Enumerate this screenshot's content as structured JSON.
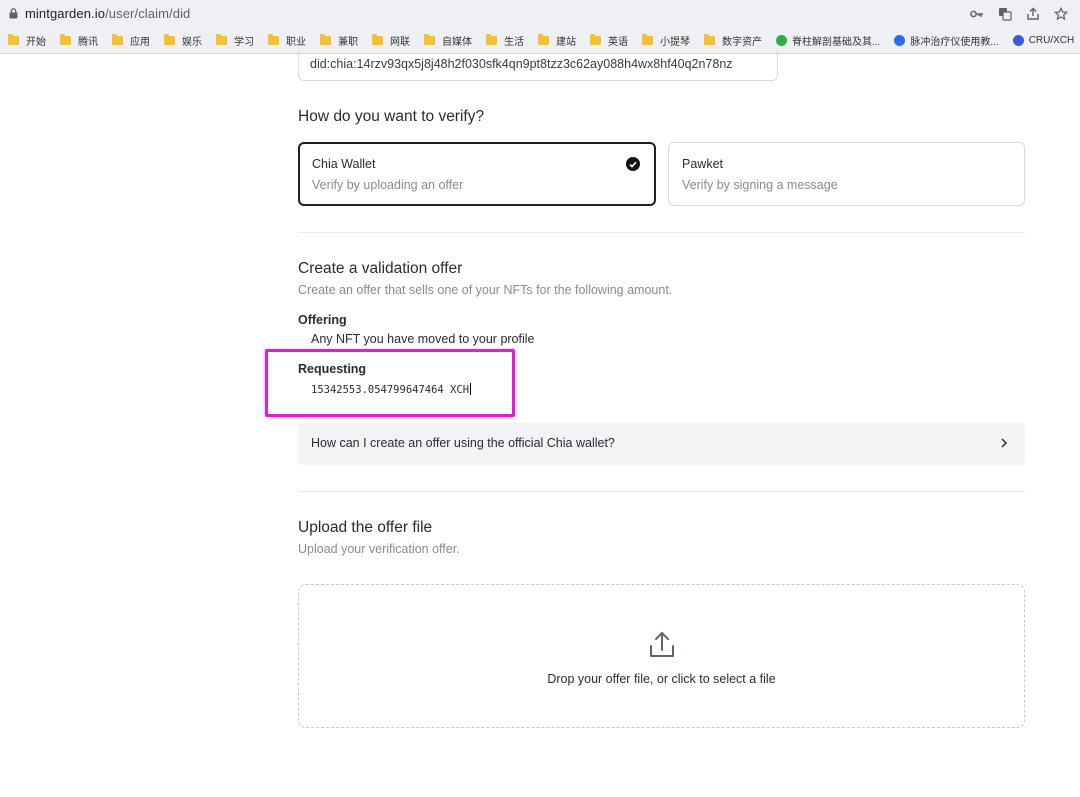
{
  "browser": {
    "url_host": "mintgarden.io",
    "url_path": "/user/claim/did",
    "bookmarks": [
      {
        "label": "开始",
        "icon": "folder-icon"
      },
      {
        "label": "腾讯",
        "icon": "folder-icon"
      },
      {
        "label": "应用",
        "icon": "folder-icon"
      },
      {
        "label": "娱乐",
        "icon": "folder-icon"
      },
      {
        "label": "学习",
        "icon": "folder-icon"
      },
      {
        "label": "职业",
        "icon": "folder-icon"
      },
      {
        "label": "兼职",
        "icon": "folder-icon"
      },
      {
        "label": "网联",
        "icon": "folder-icon"
      },
      {
        "label": "自媒体",
        "icon": "folder-icon"
      },
      {
        "label": "生活",
        "icon": "folder-icon"
      },
      {
        "label": "建站",
        "icon": "folder-icon"
      },
      {
        "label": "英语",
        "icon": "folder-icon"
      },
      {
        "label": "小提琴",
        "icon": "folder-icon"
      },
      {
        "label": "数字资产",
        "icon": "folder-icon"
      },
      {
        "label": "脊柱解剖基础及其...",
        "icon": "green-site-icon"
      },
      {
        "label": "脉冲治疗仪使用教...",
        "icon": "baidu-paw-icon"
      },
      {
        "label": "CRU/XCH",
        "icon": "blue-site-icon"
      }
    ]
  },
  "did_field": {
    "value": "did:chia:14rzv93qx5j8j48h2f030sfk4qn9pt8tzz3c62ay088h4wx8hf40q2n78nz"
  },
  "verify": {
    "heading": "How do you want to verify?",
    "options": [
      {
        "title": "Chia Wallet",
        "subtitle": "Verify by uploading an offer",
        "selected": true
      },
      {
        "title": "Pawket",
        "subtitle": "Verify by signing a message",
        "selected": false
      }
    ]
  },
  "validation": {
    "heading": "Create a validation offer",
    "subtitle": "Create an offer that sells one of your NFTs for the following amount.",
    "offering_label": "Offering",
    "offering_value": "Any NFT you have moved to your profile",
    "requesting_label": "Requesting",
    "requesting_value": "15342553.054799647464 XCH",
    "faq": "How can I create an offer using the official Chia wallet?"
  },
  "upload": {
    "heading": "Upload the offer file",
    "subtitle": "Upload your verification offer.",
    "drop_text": "Drop your offer file, or click to select a file"
  },
  "colors": {
    "highlight": "#e01fd4",
    "selected_border": "#1f1f25",
    "muted_text": "#8a8a93",
    "faq_bg": "#f2f3f5"
  }
}
